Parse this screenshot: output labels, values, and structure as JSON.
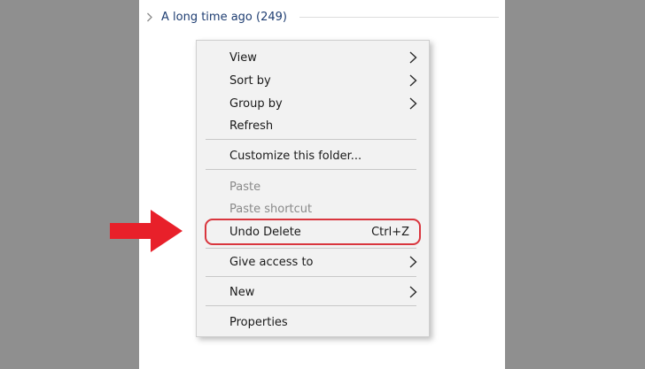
{
  "group": {
    "title": "A long time ago (249)"
  },
  "context_menu": {
    "items": [
      {
        "label": "View",
        "submenu": true,
        "enabled": true
      },
      {
        "label": "Sort by",
        "submenu": true,
        "enabled": true
      },
      {
        "label": "Group by",
        "submenu": true,
        "enabled": true
      },
      {
        "label": "Refresh",
        "submenu": false,
        "enabled": true
      },
      {
        "label": "Customize this folder...",
        "submenu": false,
        "enabled": true
      },
      {
        "label": "Paste",
        "submenu": false,
        "enabled": false
      },
      {
        "label": "Paste shortcut",
        "submenu": false,
        "enabled": false
      },
      {
        "label": "Undo Delete",
        "shortcut": "Ctrl+Z",
        "submenu": false,
        "enabled": true,
        "highlighted": true
      },
      {
        "label": "Give access to",
        "submenu": true,
        "enabled": true
      },
      {
        "label": "New",
        "submenu": true,
        "enabled": true
      },
      {
        "label": "Properties",
        "submenu": false,
        "enabled": true
      }
    ]
  },
  "colors": {
    "backdrop": "#8f8f8f",
    "menu_background": "#f2f2f2",
    "highlight_ring": "#d9363e",
    "arrow": "#e8202a",
    "group_title": "#1f3e72"
  },
  "icons": {
    "group_chevron": "chevron-right-icon",
    "submenu_arrow": "chevron-right-icon",
    "pointer": "red-arrow-icon"
  }
}
